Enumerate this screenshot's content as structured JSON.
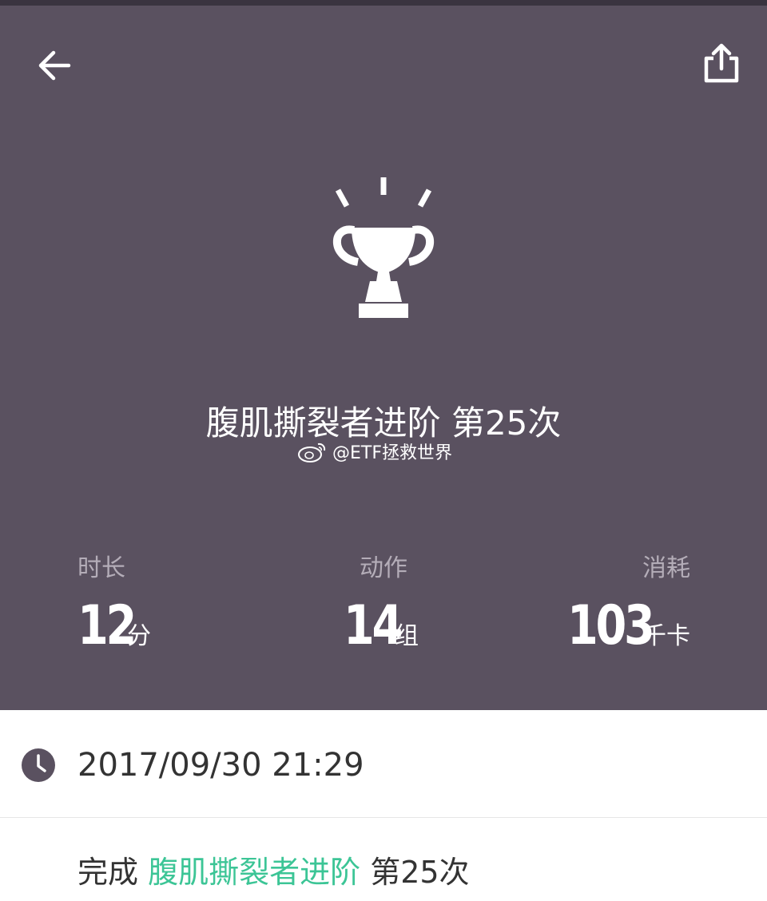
{
  "header": {
    "back_icon": "arrow-left-icon",
    "share_icon": "share-icon"
  },
  "hero": {
    "trophy_icon": "trophy-icon",
    "title": "腹肌撕裂者进阶 第25次",
    "watermark": "@ETF拯救世界",
    "background": "#5a5160"
  },
  "stats": [
    {
      "label": "时长",
      "value": "12",
      "unit": "分"
    },
    {
      "label": "动作",
      "value": "14",
      "unit": "组"
    },
    {
      "label": "消耗",
      "value": "103",
      "unit": "千卡"
    }
  ],
  "record": {
    "clock_icon": "clock-icon",
    "datetime": "2017/09/30 21:29"
  },
  "summary": {
    "prefix": "完成 ",
    "workout": "腹肌撕裂者进阶",
    "suffix": " 第25次",
    "accent_color": "#3cc596"
  }
}
